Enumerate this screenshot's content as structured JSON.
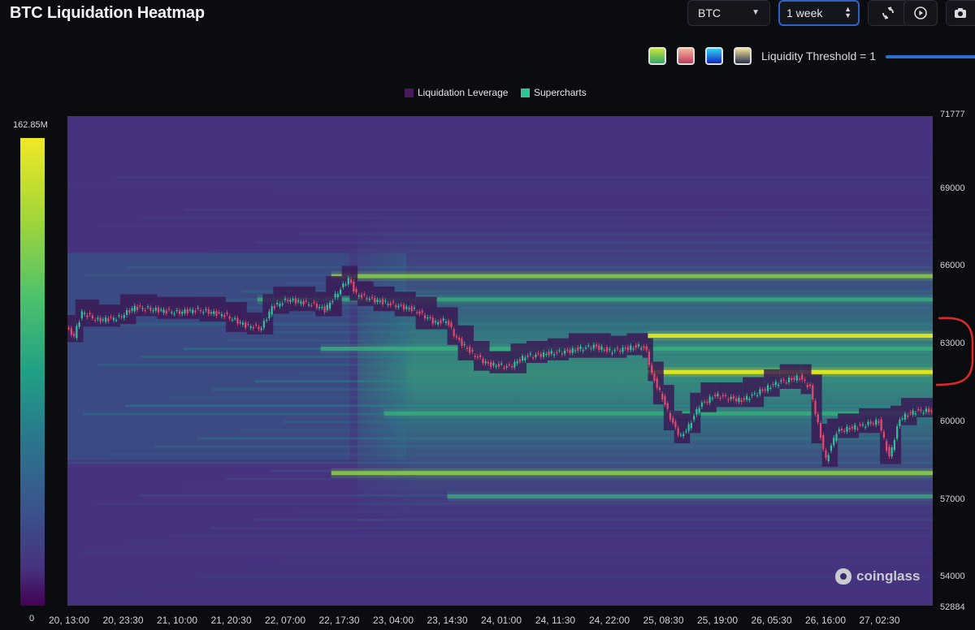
{
  "title": "BTC Liquidation Heatmap",
  "controls": {
    "symbol": "BTC",
    "range": "1 week",
    "threshold_label": "Liquidity Threshold = 1"
  },
  "palettes": [
    {
      "from": "#2ea86b",
      "to": "#c8e43c"
    },
    {
      "from": "#c0395b",
      "to": "#f2b6a0"
    },
    {
      "from": "#1326c8",
      "to": "#2fd2f0"
    },
    {
      "from": "#27304f",
      "to": "#f2e09a"
    }
  ],
  "colors": {
    "background": "#0b0c10",
    "heatmap_base": "#46327e",
    "candle_up": "#2ec49a",
    "candle_down": "#e8496b",
    "slider": "#2d6fd0",
    "annotation": "#e02828"
  },
  "chart_data": {
    "type": "heatmap",
    "title": "BTC Liquidation Heatmap",
    "legend": [
      {
        "label": "Liquidation Leverage",
        "color": "#4a1a5c"
      },
      {
        "label": "Supercharts",
        "color": "#2ec49a"
      }
    ],
    "legend_position": "top-center",
    "colorbar": {
      "max_label": "162.85M",
      "min_label": "0",
      "max": 162850000,
      "min": 0
    },
    "ylim": [
      52884,
      71777
    ],
    "y_ticks": [
      52884,
      54000,
      57000,
      60000,
      63000,
      66000,
      69000,
      71777
    ],
    "x_tick_labels": [
      "20, 13:00",
      "20, 23:30",
      "21, 10:00",
      "21, 20:30",
      "22, 07:00",
      "22, 17:30",
      "23, 04:00",
      "23, 14:30",
      "24, 01:00",
      "24, 11:30",
      "24, 22:00",
      "25, 08:30",
      "25, 19:00",
      "26, 05:30",
      "26, 16:00",
      "27, 02:30"
    ],
    "x_range_hours": [
      0,
      164
    ],
    "price_path": [
      [
        0,
        63600
      ],
      [
        1.5,
        63300
      ],
      [
        3,
        64200
      ],
      [
        6,
        63900
      ],
      [
        10,
        64000
      ],
      [
        13,
        64400
      ],
      [
        17,
        64300
      ],
      [
        21,
        64200
      ],
      [
        25,
        64300
      ],
      [
        30,
        64100
      ],
      [
        34,
        63700
      ],
      [
        37,
        63600
      ],
      [
        39,
        64400
      ],
      [
        42,
        64700
      ],
      [
        47,
        64500
      ],
      [
        49,
        64300
      ],
      [
        52,
        65100
      ],
      [
        53.5,
        65500
      ],
      [
        55,
        64900
      ],
      [
        58,
        64700
      ],
      [
        62,
        64500
      ],
      [
        66,
        64300
      ],
      [
        70,
        63800
      ],
      [
        72,
        63900
      ],
      [
        74,
        63200
      ],
      [
        77,
        62600
      ],
      [
        80,
        62200
      ],
      [
        84,
        62100
      ],
      [
        87,
        62500
      ],
      [
        91,
        62600
      ],
      [
        95,
        62700
      ],
      [
        100,
        62900
      ],
      [
        103,
        62700
      ],
      [
        106,
        62800
      ],
      [
        109,
        62900
      ],
      [
        110,
        62700
      ],
      [
        111,
        61800
      ],
      [
        113,
        60900
      ],
      [
        115,
        59900
      ],
      [
        116.5,
        59400
      ],
      [
        118,
        59800
      ],
      [
        120,
        60600
      ],
      [
        123,
        61000
      ],
      [
        128,
        60800
      ],
      [
        132,
        61200
      ],
      [
        135,
        61500
      ],
      [
        139,
        61700
      ],
      [
        141,
        61300
      ],
      [
        143,
        59400
      ],
      [
        144,
        58500
      ],
      [
        146,
        59600
      ],
      [
        150,
        59800
      ],
      [
        154,
        60000
      ],
      [
        156,
        58600
      ],
      [
        158,
        60100
      ],
      [
        161,
        60400
      ],
      [
        164,
        60400
      ]
    ],
    "liquidation_bands": [
      {
        "price": 65600,
        "intensity": 0.62
      },
      {
        "price": 64700,
        "intensity": 0.45
      },
      {
        "price": 63300,
        "intensity": 0.95
      },
      {
        "price": 62800,
        "intensity": 0.52
      },
      {
        "price": 61900,
        "intensity": 1.0
      },
      {
        "price": 60300,
        "intensity": 0.5
      },
      {
        "price": 58000,
        "intensity": 0.72
      },
      {
        "price": 57100,
        "intensity": 0.4
      }
    ]
  }
}
